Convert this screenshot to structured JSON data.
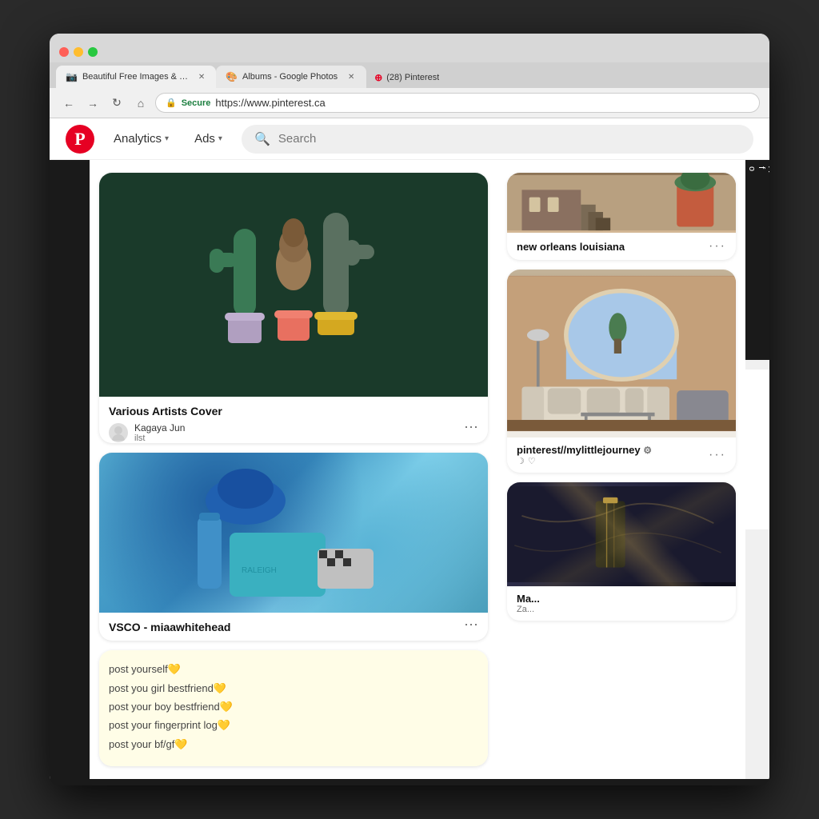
{
  "browser": {
    "tabs": [
      {
        "id": "tab1",
        "label": "Beautiful Free Images & Pictur...",
        "icon": "camera-icon",
        "active": true
      },
      {
        "id": "tab2",
        "label": "Albums - Google Photos",
        "icon": "photos-icon",
        "active": false
      },
      {
        "id": "tab3",
        "label": "(28) Pinterest",
        "icon": "pinterest-icon",
        "active": false
      }
    ],
    "address": {
      "secure_label": "Secure",
      "url": "https://www.pinterest.ca"
    }
  },
  "pinterest": {
    "header": {
      "logo_letter": "P",
      "nav_items": [
        {
          "label": "Analytics",
          "has_dropdown": true
        },
        {
          "label": "Ads",
          "has_dropdown": true
        }
      ],
      "search_placeholder": "Search"
    },
    "pins": {
      "col1": [
        {
          "id": "pin1",
          "type": "illustration",
          "title": "Various Artists Cover",
          "author_name": "Kagaya Jun",
          "author_subtitle": "ilst"
        },
        {
          "id": "pin2",
          "type": "photo",
          "title": "VSCO - miaawhitehead"
        },
        {
          "id": "pin3",
          "type": "text",
          "lines": [
            "post yourself💛",
            "post you girl bestfriend💛",
            "post your boy bestfriend💛",
            "post your fingerprint log💛",
            "post your bf/gf💛"
          ]
        }
      ],
      "right": [
        {
          "id": "rpin1",
          "type": "place",
          "title": "new orleans louisiana"
        },
        {
          "id": "rpin2",
          "type": "interior",
          "title": "pinterest//mylittlejourney",
          "has_gear": true,
          "has_heart": true
        },
        {
          "id": "rpin3",
          "type": "marble",
          "title": "Ma...",
          "subtitle": "Za..."
        }
      ],
      "far_right": [
        {
          "id": "frpin1",
          "type": "dark",
          "partial_text": "A",
          "partial_text2": "fo"
        }
      ]
    }
  }
}
